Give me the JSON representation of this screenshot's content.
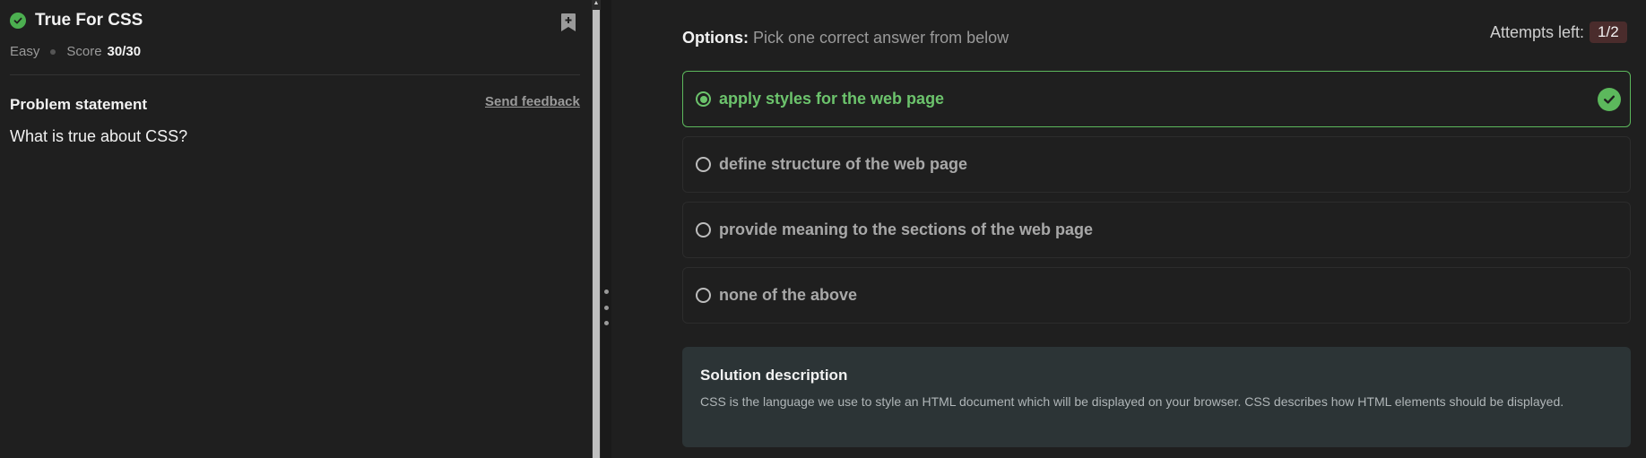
{
  "problem": {
    "title": "True For CSS",
    "difficulty": "Easy",
    "score_label": "Score",
    "score_value": "30/30",
    "statement_heading": "Problem statement",
    "feedback_link": "Send feedback",
    "question": "What is true about CSS?"
  },
  "options": {
    "heading_bold": "Options:",
    "heading_text": " Pick one correct answer from below",
    "attempts_label": "Attempts left:",
    "attempts_value": "1/2",
    "items": [
      {
        "label": "apply styles for the web page",
        "state": "correct-selected"
      },
      {
        "label": "define structure of the web page",
        "state": "unselected"
      },
      {
        "label": "provide meaning to the sections of the web page",
        "state": "unselected"
      },
      {
        "label": "none of the above",
        "state": "unselected"
      }
    ]
  },
  "solution": {
    "heading": "Solution description",
    "text": "CSS is the language we use to style an HTML document which will be displayed on your browser. CSS describes how HTML elements should be displayed."
  },
  "icons": {
    "solved": "check-circle-icon",
    "bookmark": "bookmark-add-icon",
    "correct": "check-circle-icon"
  },
  "colors": {
    "correct_green": "#5cb85c",
    "attempts_badge": "#4a2c2c",
    "solution_bg": "#2c3436"
  }
}
